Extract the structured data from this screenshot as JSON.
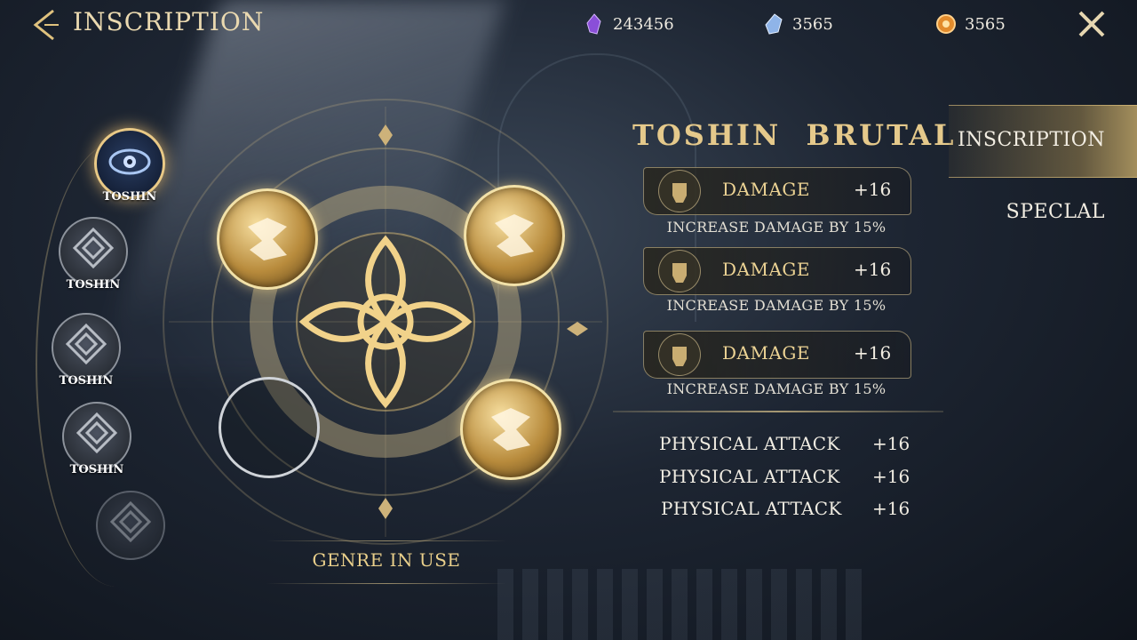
{
  "header": {
    "title": "INSCRIPTION",
    "currencies": [
      {
        "icon": "purple-crystal-icon",
        "value": "243456"
      },
      {
        "icon": "blue-crystal-icon",
        "value": "3565"
      },
      {
        "icon": "gold-orb-icon",
        "value": "3565"
      }
    ]
  },
  "slots": [
    {
      "label": "TOSHIN",
      "state": "active",
      "icon": "eye-emblem-icon"
    },
    {
      "label": "TOSHIN",
      "state": "locked",
      "icon": "lattice-emblem-icon"
    },
    {
      "label": "TOSHIN",
      "state": "locked",
      "icon": "lattice-emblem-icon"
    },
    {
      "label": "TOSHIN",
      "state": "locked",
      "icon": "lattice-emblem-icon"
    },
    {
      "label": "",
      "state": "locked",
      "icon": "lattice-emblem-icon"
    }
  ],
  "wheel": {
    "center_icon": "celtic-knot-icon",
    "sockets": [
      "filled",
      "filled",
      "empty",
      "filled"
    ],
    "genre_label": "GENRE IN USE"
  },
  "set": {
    "name": "TOSHIN  BRUTAL",
    "stats": [
      {
        "icon": "fist-icon",
        "name": "DAMAGE",
        "value": "+16",
        "desc": "INCREASE DAMAGE BY 15%"
      },
      {
        "icon": "fist-icon",
        "name": "DAMAGE",
        "value": "+16",
        "desc": "INCREASE DAMAGE BY 15%"
      },
      {
        "icon": "fist-icon",
        "name": "DAMAGE",
        "value": "+16",
        "desc": "INCREASE DAMAGE BY 15%"
      }
    ],
    "attributes": [
      {
        "name": "PHYSICAL ATTACK",
        "value": "+16"
      },
      {
        "name": "PHYSICAL ATTACK",
        "value": "+16"
      },
      {
        "name": "PHYSICAL ATTACK",
        "value": "+16"
      }
    ]
  },
  "tabs": [
    {
      "label": "INSCRIPTION",
      "selected": true
    },
    {
      "label": "SPECLAL",
      "selected": false
    }
  ],
  "colors": {
    "gold": "#e5c98b",
    "accent_glow": "#f2e1a8"
  }
}
